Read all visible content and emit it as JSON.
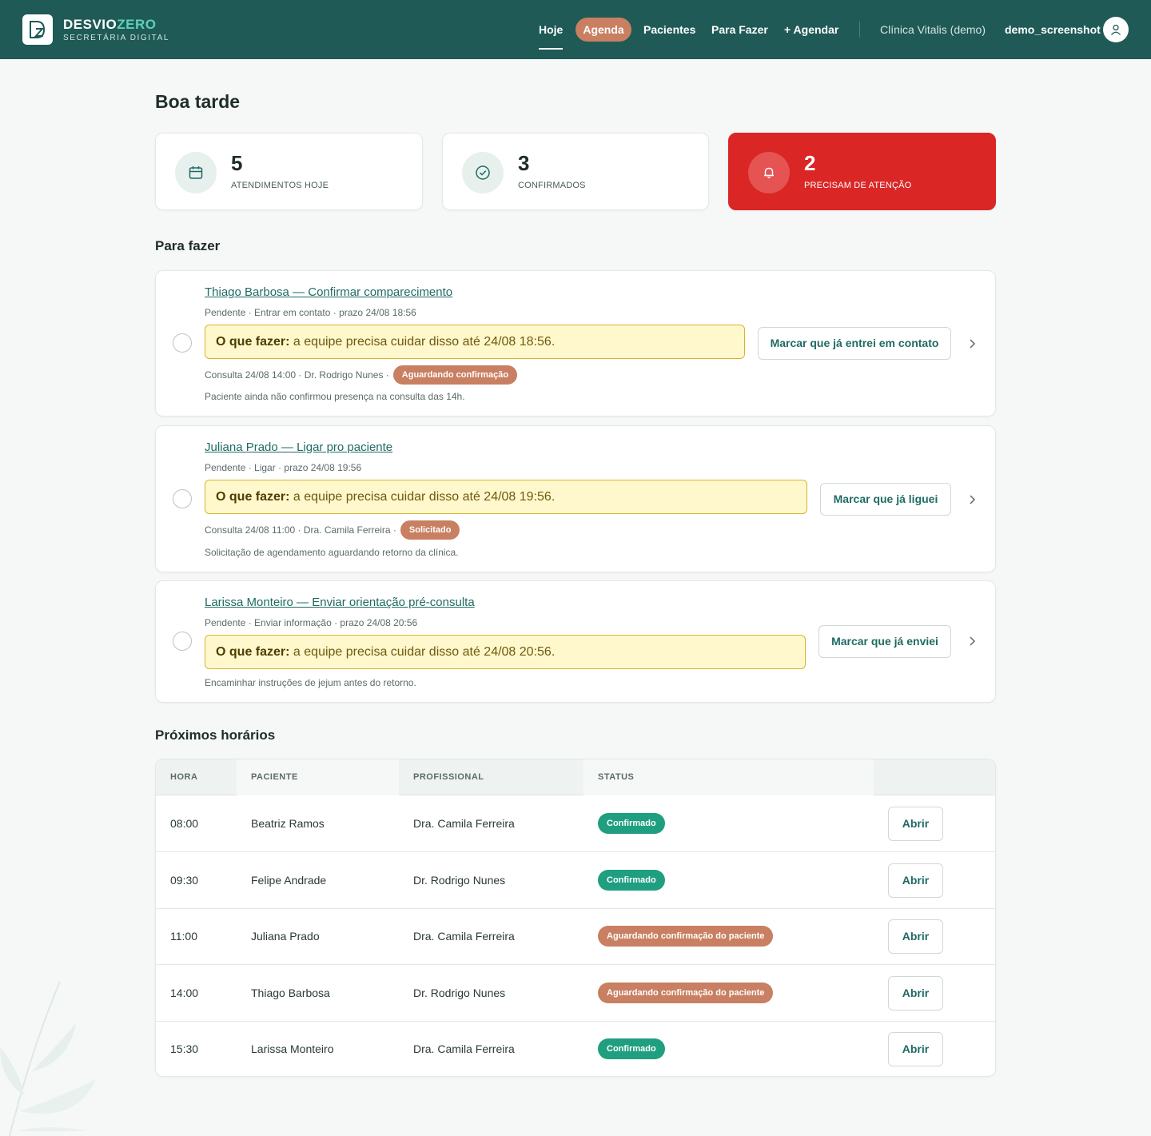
{
  "brand": {
    "name_a": "DESVIO",
    "name_b": "ZERO",
    "subtitle": "SECRETÁRIA DIGITAL",
    "logo_text": "DZ"
  },
  "nav": {
    "items": [
      {
        "label": "Hoje",
        "active": true
      },
      {
        "label": "Agenda"
      },
      {
        "label": "Pacientes"
      },
      {
        "label": "Para Fazer"
      },
      {
        "label": "+ Agendar"
      }
    ],
    "clinic": "Clínica Vitalis (demo)",
    "username": "demo_screenshot"
  },
  "greeting": "Boa tarde",
  "stats": [
    {
      "value": "5",
      "label": "ATENDIMENTOS HOJE",
      "icon": "calendar-icon"
    },
    {
      "value": "3",
      "label": "CONFIRMADOS",
      "icon": "check-circle-icon"
    },
    {
      "value": "2",
      "label": "PRECISAM DE ATENÇÃO",
      "icon": "bell-icon"
    }
  ],
  "todo_section": {
    "title": "Para fazer",
    "todo_prefix": "O que fazer:",
    "tasks": [
      {
        "title": "Thiago Barbosa — Confirmar comparecimento",
        "meta": "Pendente · Entrar em contato · prazo 24/08 18:56",
        "todo": "a equipe precisa cuidar disso até 24/08 18:56.",
        "consult": "Consulta 24/08 14:00 · Dr. Rodrigo Nunes ·",
        "badge": "Aguardando confirmação",
        "note": "Paciente ainda não confirmou presença na consulta das 14h.",
        "action": "Marcar que já entrei em contato"
      },
      {
        "title": "Juliana Prado — Ligar pro paciente",
        "meta": "Pendente · Ligar · prazo 24/08 19:56",
        "todo": "a equipe precisa cuidar disso até 24/08 19:56.",
        "consult": "Consulta 24/08 11:00 · Dra. Camila Ferreira ·",
        "badge": "Solicitado",
        "note": "Solicitação de agendamento aguardando retorno da clínica.",
        "action": "Marcar que já liguei"
      },
      {
        "title": "Larissa Monteiro — Enviar orientação pré-consulta",
        "meta": "Pendente · Enviar informação · prazo 24/08 20:56",
        "todo": "a equipe precisa cuidar disso até 24/08 20:56.",
        "note": "Encaminhar instruções de jejum antes do retorno.",
        "action": "Marcar que já enviei"
      }
    ]
  },
  "schedule": {
    "title": "Próximos horários",
    "headers": [
      "HORA",
      "PACIENTE",
      "PROFISSIONAL",
      "STATUS"
    ],
    "open_label": "Abrir",
    "rows": [
      {
        "time": "08:00",
        "patient": "Beatriz Ramos",
        "professional": "Dra. Camila Ferreira",
        "status": "Confirmado",
        "status_color": "#1f9e80"
      },
      {
        "time": "09:30",
        "patient": "Felipe Andrade",
        "professional": "Dr. Rodrigo Nunes",
        "status": "Confirmado",
        "status_color": "#1f9e80"
      },
      {
        "time": "11:00",
        "patient": "Juliana Prado",
        "professional": "Dra. Camila Ferreira",
        "status": "Aguardando confirmação do paciente",
        "status_color": "#c87f62"
      },
      {
        "time": "14:00",
        "patient": "Thiago Barbosa",
        "professional": "Dr. Rodrigo Nunes",
        "status": "Aguardando confirmação do paciente",
        "status_color": "#c87f62"
      },
      {
        "time": "15:30",
        "patient": "Larissa Monteiro",
        "professional": "Dra. Camila Ferreira",
        "status": "Confirmado",
        "status_color": "#1f9e80"
      }
    ]
  },
  "colors": {
    "topbar": "#1f5a56",
    "accent": "#c87f62",
    "alert": "#db2626",
    "confirmed": "#1f9e80"
  }
}
